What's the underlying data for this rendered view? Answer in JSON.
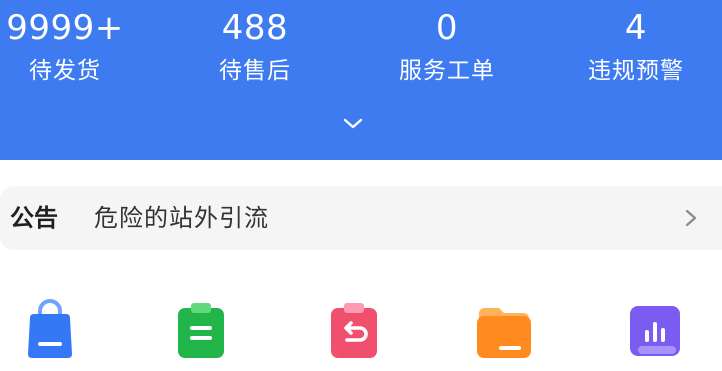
{
  "stats": [
    {
      "value": "9999+",
      "label": "待发货"
    },
    {
      "value": "488",
      "label": "待售后"
    },
    {
      "value": "0",
      "label": "服务工单"
    },
    {
      "value": "4",
      "label": "违规预警"
    }
  ],
  "header": {
    "background_color": "#3f7bf0",
    "expand_icon": "chevron-down-icon"
  },
  "notice": {
    "tag": "公告",
    "text": "危险的站外引流",
    "arrow_icon": "chevron-right-icon"
  },
  "shortcut_icons": [
    {
      "icon": "shopping-bag-icon",
      "color": "#3478f6"
    },
    {
      "icon": "clipboard-icon",
      "color": "#22b64a"
    },
    {
      "icon": "return-icon",
      "color": "#f0506e"
    },
    {
      "icon": "folder-icon",
      "color": "#ff8a1f"
    },
    {
      "icon": "chart-icon",
      "color": "#7a5cf0"
    }
  ]
}
